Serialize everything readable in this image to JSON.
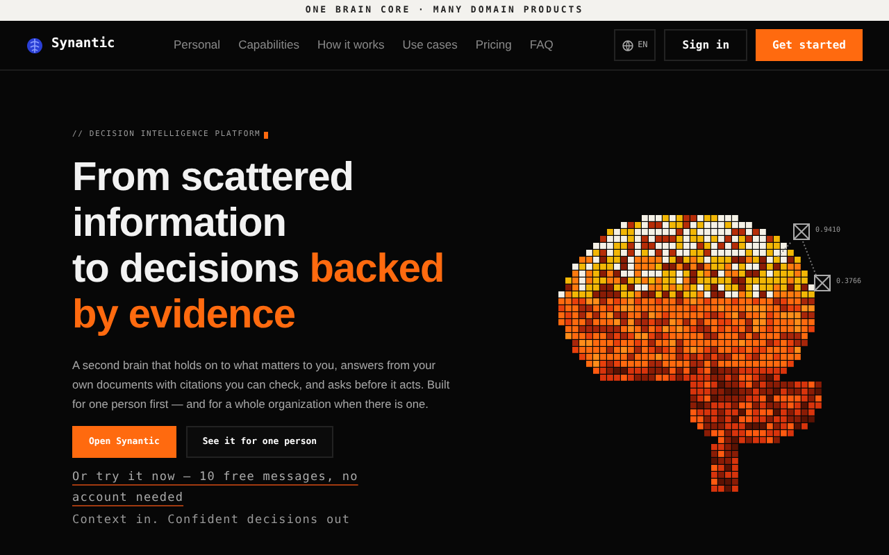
{
  "banner": "ONE BRAIN CORE · MANY DOMAIN PRODUCTS",
  "nav": {
    "brand": "Synantic",
    "links": [
      "Personal",
      "Capabilities",
      "How it works",
      "Use cases",
      "Pricing",
      "FAQ"
    ],
    "language": "EN",
    "sign_in": "Sign in",
    "cta": "Get started"
  },
  "hero": {
    "eyebrow": "// DECISION INTELLIGENCE PLATFORM",
    "heading_lines": [
      [
        {
          "text": "From scattered",
          "accent": false
        }
      ],
      [
        {
          "text": "information",
          "accent": false
        }
      ],
      [
        {
          "text": "to decisions ",
          "accent": false
        },
        {
          "text": "backed",
          "accent": true
        }
      ],
      [
        {
          "text": "by evidence",
          "accent": true
        }
      ]
    ],
    "description": "A second brain that holds on to what matters to you, answers from your own documents with citations you can check, and asks before it acts. Built for one person first — and for a whole organization when there is one.",
    "primary_button": "Open Synantic",
    "secondary_button": "See it for one person",
    "trial_link": "Or try it now — 10 free messages, no account needed",
    "tagline": "Context in. Confident decisions out"
  },
  "brain": {
    "nodes": [
      {
        "label": "0.9410"
      },
      {
        "label": "0.3766"
      }
    ]
  }
}
